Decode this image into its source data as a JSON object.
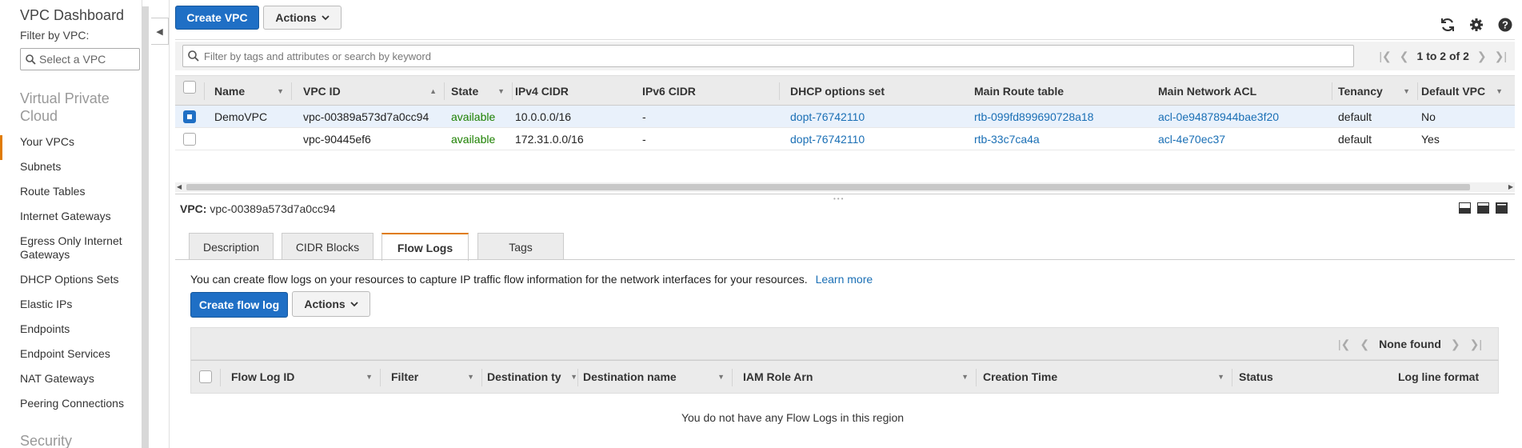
{
  "sidebar": {
    "title": "VPC Dashboard",
    "filter_label": "Filter by VPC:",
    "filter_placeholder": "Select a VPC",
    "section_title": "Virtual Private Cloud",
    "items": [
      {
        "label": "Your VPCs",
        "active": true
      },
      {
        "label": "Subnets"
      },
      {
        "label": "Route Tables"
      },
      {
        "label": "Internet Gateways"
      },
      {
        "label": "Egress Only Internet Gateways"
      },
      {
        "label": "DHCP Options Sets"
      },
      {
        "label": "Elastic IPs"
      },
      {
        "label": "Endpoints"
      },
      {
        "label": "Endpoint Services"
      },
      {
        "label": "NAT Gateways"
      },
      {
        "label": "Peering Connections"
      }
    ],
    "next_section_title": "Security"
  },
  "toolbar": {
    "create_label": "Create VPC",
    "actions_label": "Actions",
    "icons": [
      "refresh-icon",
      "gear-icon",
      "help-icon"
    ]
  },
  "search": {
    "placeholder": "Filter by tags and attributes or search by keyword",
    "pager_text": "1 to 2 of 2"
  },
  "vpc_table": {
    "columns": [
      "Name",
      "VPC ID",
      "State",
      "IPv4 CIDR",
      "IPv6 CIDR",
      "DHCP options set",
      "Main Route table",
      "Main Network ACL",
      "Tenancy",
      "Default VPC"
    ],
    "rows": [
      {
        "selected": true,
        "name": "DemoVPC",
        "vpc_id": "vpc-00389a573d7a0cc94",
        "state": "available",
        "ipv4": "10.0.0.0/16",
        "ipv6": "-",
        "dhcp": "dopt-76742110",
        "route": "rtb-099fd899690728a18",
        "acl": "acl-0e94878944bae3f20",
        "tenancy": "default",
        "default_vpc": "No"
      },
      {
        "selected": false,
        "name": "",
        "vpc_id": "vpc-90445ef6",
        "state": "available",
        "ipv4": "172.31.0.0/16",
        "ipv6": "-",
        "dhcp": "dopt-76742110",
        "route": "rtb-33c7ca4a",
        "acl": "acl-4e70ec37",
        "tenancy": "default",
        "default_vpc": "Yes"
      }
    ]
  },
  "detail": {
    "label": "VPC:",
    "vpc_id": "vpc-00389a573d7a0cc94",
    "tabs": [
      "Description",
      "CIDR Blocks",
      "Flow Logs",
      "Tags"
    ],
    "active_tab": "Flow Logs",
    "flow_logs": {
      "description": "You can create flow logs on your resources to capture IP traffic flow information for the network interfaces for your resources.",
      "learn_more": "Learn more",
      "create_label": "Create flow log",
      "actions_label": "Actions",
      "pager_text": "None found",
      "columns": [
        "Flow Log ID",
        "Filter",
        "Destination ty",
        "Destination name",
        "IAM Role Arn",
        "Creation Time",
        "Status",
        "Log line format"
      ],
      "empty_text": "You do not have any Flow Logs in this region"
    }
  },
  "colors": {
    "primary": "#1f6fc5",
    "link": "#1a6fb5",
    "available": "#1d8102",
    "active_accent": "#e07b00"
  }
}
